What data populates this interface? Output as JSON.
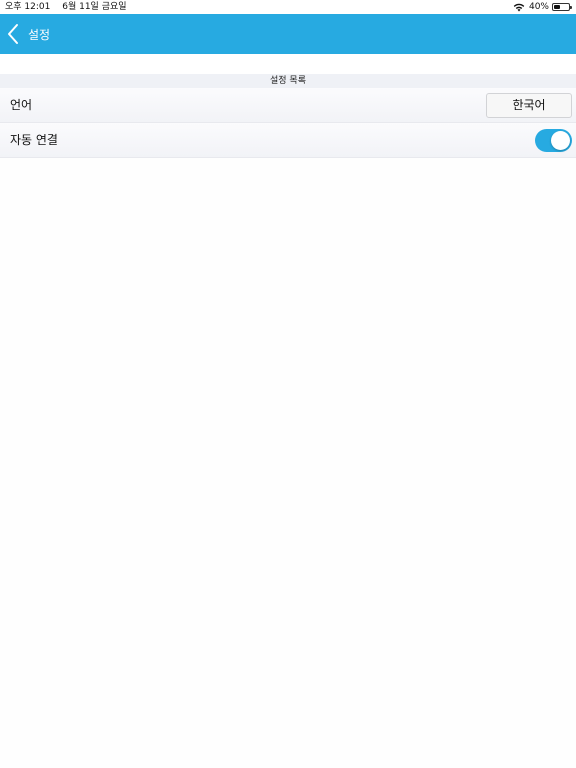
{
  "status_bar": {
    "time": "오후 12:01",
    "date": "6월 11일 금요일",
    "battery_percent_text": "40%",
    "battery_level": 0.4,
    "icons": [
      "wifi-icon",
      "battery-icon"
    ]
  },
  "nav": {
    "title": "설정",
    "back_icon": "chevron-left-icon",
    "color": "#27aae1"
  },
  "section": {
    "header": "설정 목록"
  },
  "rows": {
    "language": {
      "label": "언어",
      "value": "한국어"
    },
    "auto_connect": {
      "label": "자동 연결",
      "enabled": true
    }
  },
  "colors": {
    "accent": "#27aae1",
    "section_bg": "#eff1f6"
  }
}
